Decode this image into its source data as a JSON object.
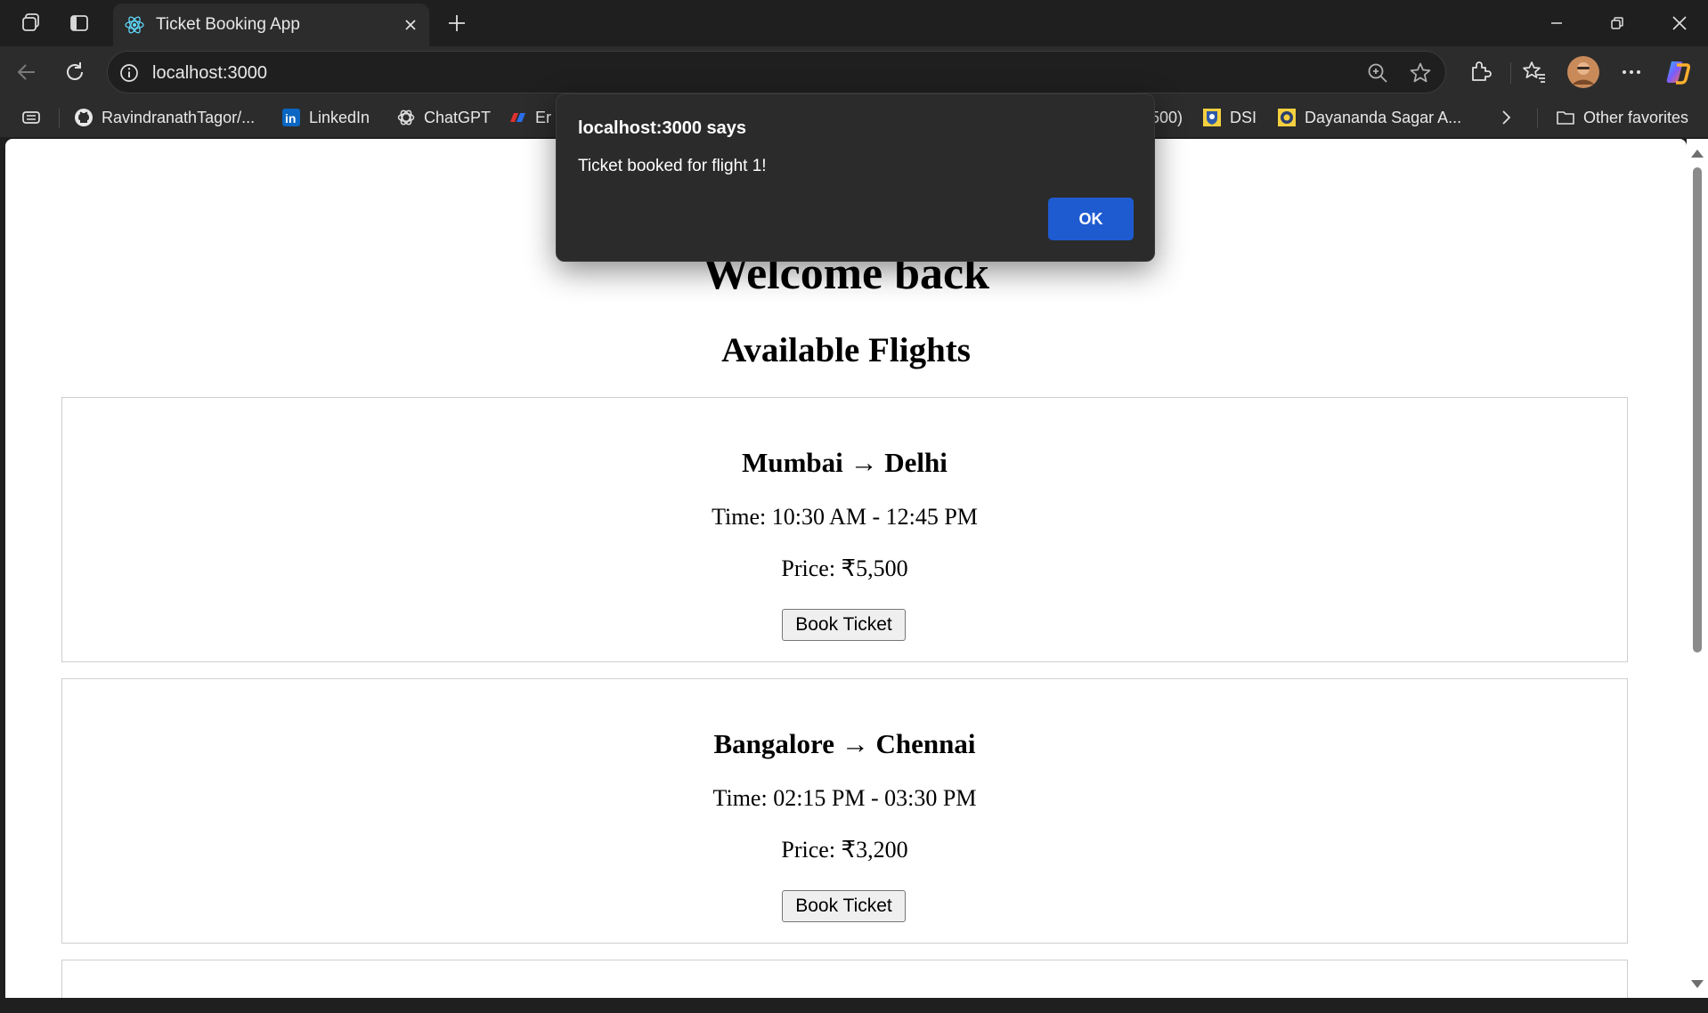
{
  "browser": {
    "tab_title": "Ticket Booking App",
    "url": "localhost:3000"
  },
  "favorites": {
    "items": [
      {
        "label": "RavindranathTagor/...",
        "icon": "github-icon"
      },
      {
        "label": "LinkedIn",
        "icon": "linkedin-icon"
      },
      {
        "label": "ChatGPT",
        "icon": "chatgpt-icon"
      },
      {
        "label": "Er",
        "icon": "bookmark-icon"
      },
      {
        "label": "500)",
        "icon": ""
      },
      {
        "label": "DSI",
        "icon": "dsi-icon"
      },
      {
        "label": "Dayananda Sagar A...",
        "icon": "dsu-icon"
      }
    ],
    "other_label": "Other favorites"
  },
  "page": {
    "welcome": "Welcome back",
    "heading": "Available Flights",
    "flights": [
      {
        "route": "Mumbai → Delhi",
        "time": "Time: 10:30 AM - 12:45 PM",
        "price": "Price: ₹5,500",
        "button": "Book Ticket"
      },
      {
        "route": "Bangalore → Chennai",
        "time": "Time: 02:15 PM - 03:30 PM",
        "price": "Price: ₹3,200",
        "button": "Book Ticket"
      }
    ]
  },
  "dialog": {
    "title": "localhost:3000 says",
    "message": "Ticket booked for flight 1!",
    "ok_label": "OK"
  },
  "colors": {
    "dialog_ok": "#1f5bd0",
    "chrome_dark": "#1f1f1f"
  }
}
